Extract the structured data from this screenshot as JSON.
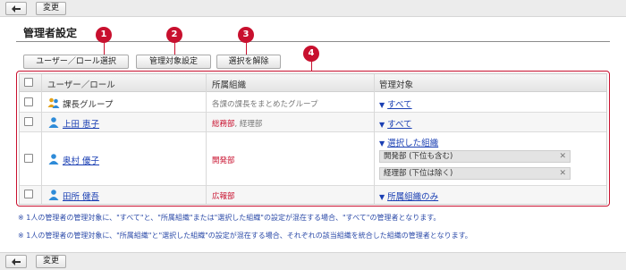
{
  "toolbar": {
    "back_icon": "back-arrow-icon",
    "change_label": "変更"
  },
  "section": {
    "title": "管理者設定"
  },
  "actions": {
    "select_user_role": "ユーザー／ロール選択",
    "set_target": "管理対象設定",
    "clear_selection": "選択を解除"
  },
  "badges": [
    "1",
    "2",
    "3",
    "4"
  ],
  "table": {
    "headers": {
      "user_role": "ユーザー／ロール",
      "dept": "所属組織",
      "target": "管理対象"
    },
    "rows": [
      {
        "icon": "group-icon",
        "name": "課長グループ",
        "dept": "各課の課長をまとめたグループ",
        "target": "すべて"
      },
      {
        "icon": "user-icon",
        "name": "上田 恵子",
        "dept": "総務部",
        "dept_sep": ",",
        "dept2": "経理部",
        "target": "すべて"
      },
      {
        "icon": "user-icon",
        "name": "奥村 優子",
        "dept": "開発部",
        "target": "選択した組織",
        "chips": [
          {
            "label": "開発部 (下位も含む)"
          },
          {
            "label": "経理部 (下位は除く)"
          }
        ]
      },
      {
        "icon": "user-icon",
        "name": "田所 健吾",
        "dept": "広報部",
        "target": "所属組織のみ"
      }
    ]
  },
  "notes": [
    "※ 1人の管理者の管理対象に、\"すべて\"と、\"所属組織\"または\"選択した組織\"の設定が混在する場合、\"すべて\"の管理者となります。",
    "※ 1人の管理者の管理対象に、\"所属組織\"と\"選択した組織\"の設定が混在する場合、それぞれの該当組織を統合した組織の管理者となります。"
  ],
  "colors": {
    "accent_red": "#c8102e",
    "link_blue": "#1a3fb3",
    "note_blue": "#2b4aa8"
  }
}
